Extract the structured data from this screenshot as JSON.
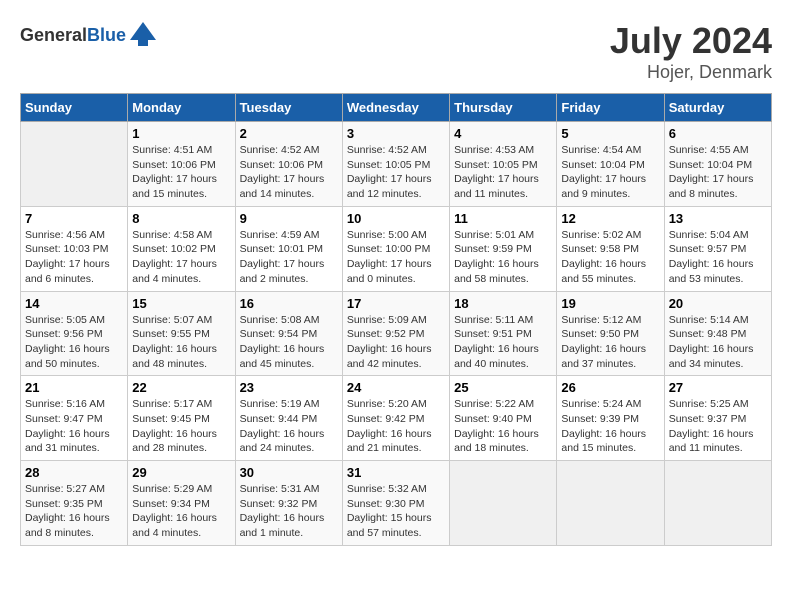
{
  "header": {
    "logo_general": "General",
    "logo_blue": "Blue",
    "month": "July 2024",
    "location": "Hojer, Denmark"
  },
  "days_of_week": [
    "Sunday",
    "Monday",
    "Tuesday",
    "Wednesday",
    "Thursday",
    "Friday",
    "Saturday"
  ],
  "weeks": [
    [
      {
        "day": "",
        "info": ""
      },
      {
        "day": "1",
        "info": "Sunrise: 4:51 AM\nSunset: 10:06 PM\nDaylight: 17 hours\nand 15 minutes."
      },
      {
        "day": "2",
        "info": "Sunrise: 4:52 AM\nSunset: 10:06 PM\nDaylight: 17 hours\nand 14 minutes."
      },
      {
        "day": "3",
        "info": "Sunrise: 4:52 AM\nSunset: 10:05 PM\nDaylight: 17 hours\nand 12 minutes."
      },
      {
        "day": "4",
        "info": "Sunrise: 4:53 AM\nSunset: 10:05 PM\nDaylight: 17 hours\nand 11 minutes."
      },
      {
        "day": "5",
        "info": "Sunrise: 4:54 AM\nSunset: 10:04 PM\nDaylight: 17 hours\nand 9 minutes."
      },
      {
        "day": "6",
        "info": "Sunrise: 4:55 AM\nSunset: 10:04 PM\nDaylight: 17 hours\nand 8 minutes."
      }
    ],
    [
      {
        "day": "7",
        "info": "Sunrise: 4:56 AM\nSunset: 10:03 PM\nDaylight: 17 hours\nand 6 minutes."
      },
      {
        "day": "8",
        "info": "Sunrise: 4:58 AM\nSunset: 10:02 PM\nDaylight: 17 hours\nand 4 minutes."
      },
      {
        "day": "9",
        "info": "Sunrise: 4:59 AM\nSunset: 10:01 PM\nDaylight: 17 hours\nand 2 minutes."
      },
      {
        "day": "10",
        "info": "Sunrise: 5:00 AM\nSunset: 10:00 PM\nDaylight: 17 hours\nand 0 minutes."
      },
      {
        "day": "11",
        "info": "Sunrise: 5:01 AM\nSunset: 9:59 PM\nDaylight: 16 hours\nand 58 minutes."
      },
      {
        "day": "12",
        "info": "Sunrise: 5:02 AM\nSunset: 9:58 PM\nDaylight: 16 hours\nand 55 minutes."
      },
      {
        "day": "13",
        "info": "Sunrise: 5:04 AM\nSunset: 9:57 PM\nDaylight: 16 hours\nand 53 minutes."
      }
    ],
    [
      {
        "day": "14",
        "info": "Sunrise: 5:05 AM\nSunset: 9:56 PM\nDaylight: 16 hours\nand 50 minutes."
      },
      {
        "day": "15",
        "info": "Sunrise: 5:07 AM\nSunset: 9:55 PM\nDaylight: 16 hours\nand 48 minutes."
      },
      {
        "day": "16",
        "info": "Sunrise: 5:08 AM\nSunset: 9:54 PM\nDaylight: 16 hours\nand 45 minutes."
      },
      {
        "day": "17",
        "info": "Sunrise: 5:09 AM\nSunset: 9:52 PM\nDaylight: 16 hours\nand 42 minutes."
      },
      {
        "day": "18",
        "info": "Sunrise: 5:11 AM\nSunset: 9:51 PM\nDaylight: 16 hours\nand 40 minutes."
      },
      {
        "day": "19",
        "info": "Sunrise: 5:12 AM\nSunset: 9:50 PM\nDaylight: 16 hours\nand 37 minutes."
      },
      {
        "day": "20",
        "info": "Sunrise: 5:14 AM\nSunset: 9:48 PM\nDaylight: 16 hours\nand 34 minutes."
      }
    ],
    [
      {
        "day": "21",
        "info": "Sunrise: 5:16 AM\nSunset: 9:47 PM\nDaylight: 16 hours\nand 31 minutes."
      },
      {
        "day": "22",
        "info": "Sunrise: 5:17 AM\nSunset: 9:45 PM\nDaylight: 16 hours\nand 28 minutes."
      },
      {
        "day": "23",
        "info": "Sunrise: 5:19 AM\nSunset: 9:44 PM\nDaylight: 16 hours\nand 24 minutes."
      },
      {
        "day": "24",
        "info": "Sunrise: 5:20 AM\nSunset: 9:42 PM\nDaylight: 16 hours\nand 21 minutes."
      },
      {
        "day": "25",
        "info": "Sunrise: 5:22 AM\nSunset: 9:40 PM\nDaylight: 16 hours\nand 18 minutes."
      },
      {
        "day": "26",
        "info": "Sunrise: 5:24 AM\nSunset: 9:39 PM\nDaylight: 16 hours\nand 15 minutes."
      },
      {
        "day": "27",
        "info": "Sunrise: 5:25 AM\nSunset: 9:37 PM\nDaylight: 16 hours\nand 11 minutes."
      }
    ],
    [
      {
        "day": "28",
        "info": "Sunrise: 5:27 AM\nSunset: 9:35 PM\nDaylight: 16 hours\nand 8 minutes."
      },
      {
        "day": "29",
        "info": "Sunrise: 5:29 AM\nSunset: 9:34 PM\nDaylight: 16 hours\nand 4 minutes."
      },
      {
        "day": "30",
        "info": "Sunrise: 5:31 AM\nSunset: 9:32 PM\nDaylight: 16 hours\nand 1 minute."
      },
      {
        "day": "31",
        "info": "Sunrise: 5:32 AM\nSunset: 9:30 PM\nDaylight: 15 hours\nand 57 minutes."
      },
      {
        "day": "",
        "info": ""
      },
      {
        "day": "",
        "info": ""
      },
      {
        "day": "",
        "info": ""
      }
    ]
  ]
}
